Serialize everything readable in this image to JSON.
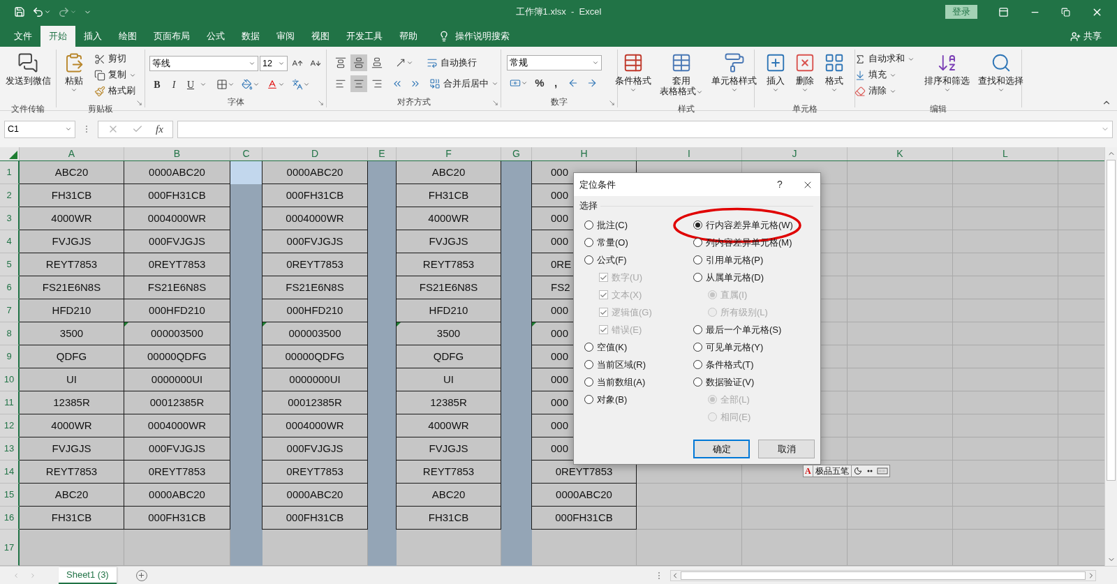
{
  "window": {
    "title": "工作簿1.xlsx  -  Excel",
    "login": "登录"
  },
  "menu_tabs": [
    {
      "label": "文件",
      "selected": false
    },
    {
      "label": "开始",
      "selected": true
    },
    {
      "label": "插入",
      "selected": false
    },
    {
      "label": "绘图",
      "selected": false
    },
    {
      "label": "页面布局",
      "selected": false
    },
    {
      "label": "公式",
      "selected": false
    },
    {
      "label": "数据",
      "selected": false
    },
    {
      "label": "审阅",
      "selected": false
    },
    {
      "label": "视图",
      "selected": false
    },
    {
      "label": "开发工具",
      "selected": false
    },
    {
      "label": "帮助",
      "selected": false
    }
  ],
  "tell_me": "操作说明搜索",
  "share": "共享",
  "ribbon": {
    "groups": [
      {
        "kind": "buttons",
        "label": "文件传输",
        "launcher": false,
        "items": [
          {
            "kind": "large",
            "lines": [
              "发送到微信"
            ],
            "menu": false
          }
        ]
      },
      {
        "kind": "buttons",
        "label": "剪贴板",
        "launcher": true,
        "items": [
          {
            "kind": "large",
            "lines": [
              "粘贴"
            ],
            "menu": true
          },
          {
            "kind": "small",
            "label": "剪切",
            "menu": false
          },
          {
            "kind": "small",
            "label": "复制",
            "menu": true
          },
          {
            "kind": "small",
            "label": "格式刷",
            "menu": false
          }
        ]
      },
      {
        "kind": "font",
        "label": "字体",
        "launcher": true,
        "font": "等线",
        "size": "12",
        "format_buttons": [
          "B",
          "I",
          "U"
        ]
      },
      {
        "kind": "alignment",
        "label": "对齐方式",
        "launcher": true,
        "vertical_align": [
          {
            "selected": false
          },
          {
            "selected": true
          },
          {
            "selected": false
          }
        ],
        "horizontal_align": [
          {
            "selected": false
          },
          {
            "selected": true
          },
          {
            "selected": false
          }
        ],
        "items": [
          {
            "kind": "small",
            "label": "自动换行",
            "menu": false
          },
          {
            "kind": "small",
            "label": "合并后居中",
            "menu": true
          }
        ]
      },
      {
        "kind": "number",
        "label": "数字",
        "launcher": true,
        "format": "常规",
        "symbols": [
          "%",
          ","
        ]
      },
      {
        "kind": "buttons",
        "label": "样式",
        "launcher": false,
        "items": [
          {
            "kind": "large",
            "lines": [
              "条件格式"
            ],
            "menu": true
          },
          {
            "kind": "large",
            "lines": [
              "套用",
              "表格格式"
            ],
            "menu": true
          },
          {
            "kind": "large",
            "lines": [
              "单元格样式"
            ],
            "menu": true
          }
        ]
      },
      {
        "kind": "buttons",
        "label": "单元格",
        "launcher": false,
        "items": [
          {
            "kind": "large",
            "lines": [
              "插入"
            ],
            "menu": true
          },
          {
            "kind": "large",
            "lines": [
              "删除"
            ],
            "menu": true
          },
          {
            "kind": "large",
            "lines": [
              "格式"
            ],
            "menu": true
          }
        ]
      },
      {
        "kind": "buttons",
        "label": "编辑",
        "launcher": false,
        "items": [
          {
            "kind": "small",
            "label": "自动求和",
            "menu": true
          },
          {
            "kind": "small",
            "label": "填充",
            "menu": true
          },
          {
            "kind": "small",
            "label": "清除",
            "menu": true
          },
          {
            "kind": "large",
            "lines": [
              "排序和筛选"
            ],
            "menu": true
          },
          {
            "kind": "large",
            "lines": [
              "查找和选择"
            ],
            "menu": true
          }
        ]
      }
    ]
  },
  "formula_bar": {
    "name_box": "C1",
    "fx": "fx"
  },
  "columns": [
    {
      "label": "A",
      "selected": false,
      "active": false
    },
    {
      "label": "B",
      "selected": false,
      "active": false
    },
    {
      "label": "C",
      "selected": true,
      "active": true
    },
    {
      "label": "D",
      "selected": false,
      "active": false
    },
    {
      "label": "E",
      "selected": true,
      "active": false
    },
    {
      "label": "F",
      "selected": false,
      "active": false
    },
    {
      "label": "G",
      "selected": true,
      "active": false
    },
    {
      "label": "H",
      "selected": false,
      "active": false
    },
    {
      "label": "I",
      "selected": false,
      "active": false
    },
    {
      "label": "J",
      "selected": false,
      "active": false
    },
    {
      "label": "K",
      "selected": false,
      "active": false
    },
    {
      "label": "L",
      "selected": false,
      "active": false
    }
  ],
  "rows": [
    {
      "header": "1",
      "a": "ABC20",
      "b": "0000ABC20",
      "d": "0000ABC20",
      "f": "ABC20",
      "h_partial": "000"
    },
    {
      "header": "2",
      "a": "FH31CB",
      "b": "000FH31CB",
      "d": "000FH31CB",
      "f": "FH31CB",
      "h_partial": "000"
    },
    {
      "header": "3",
      "a": "4000WR",
      "b": "0004000WR",
      "d": "0004000WR",
      "f": "4000WR",
      "h_partial": "000"
    },
    {
      "header": "4",
      "a": "FVJGJS",
      "b": "000FVJGJS",
      "d": "000FVJGJS",
      "f": "FVJGJS",
      "h_partial": "000"
    },
    {
      "header": "5",
      "a": "REYT7853",
      "b": "0REYT7853",
      "d": "0REYT7853",
      "f": "REYT7853",
      "h_partial": "0RE"
    },
    {
      "header": "6",
      "a": "FS21E6N8S",
      "b": "FS21E6N8S",
      "d": "FS21E6N8S",
      "f": "FS21E6N8S",
      "h_partial": "FS2"
    },
    {
      "header": "7",
      "a": "HFD210",
      "b": "000HFD210",
      "d": "000HFD210",
      "f": "HFD210",
      "h_partial": "000"
    },
    {
      "header": "8",
      "a": "3500",
      "b": "000003500",
      "d": "000003500",
      "f": "3500",
      "h_partial": "000",
      "flags": {
        "b": true,
        "d": true,
        "f": true,
        "h": true
      }
    },
    {
      "header": "9",
      "a": "QDFG",
      "b": "00000QDFG",
      "d": "00000QDFG",
      "f": "QDFG",
      "h_partial": "000"
    },
    {
      "header": "10",
      "a": "UI",
      "b": "0000000UI",
      "d": "0000000UI",
      "f": "UI",
      "h_partial": "000"
    },
    {
      "header": "11",
      "a": "12385R",
      "b": "00012385R",
      "d": "00012385R",
      "f": "12385R",
      "h_partial": "000"
    },
    {
      "header": "12",
      "a": "4000WR",
      "b": "0004000WR",
      "d": "0004000WR",
      "f": "4000WR",
      "h_partial": "000"
    },
    {
      "header": "13",
      "a": "FVJGJS",
      "b": "000FVJGJS",
      "d": "000FVJGJS",
      "f": "FVJGJS",
      "h_partial": "000"
    },
    {
      "header": "14",
      "a": "REYT7853",
      "b": "0REYT7853",
      "d": "0REYT7853",
      "f": "REYT7853",
      "h": "0REYT7853"
    },
    {
      "header": "15",
      "a": "ABC20",
      "b": "0000ABC20",
      "d": "0000ABC20",
      "f": "ABC20",
      "h": "0000ABC20"
    },
    {
      "header": "16",
      "a": "FH31CB",
      "b": "000FH31CB",
      "d": "000FH31CB",
      "f": "FH31CB",
      "h": "000FH31CB"
    },
    {
      "header": "17"
    }
  ],
  "sheet_tabs": [
    {
      "label": "Sheet1 (3)",
      "selected": true
    }
  ],
  "dialog": {
    "title": "定位条件",
    "help": "?",
    "section": "选择",
    "left_options": [
      {
        "label": "批注(C)",
        "kind": "radio",
        "selected": false,
        "disabled": false,
        "highlighted": false
      },
      {
        "label": "常量(O)",
        "kind": "radio",
        "selected": false,
        "disabled": false,
        "highlighted": false
      },
      {
        "label": "公式(F)",
        "kind": "radio",
        "selected": false,
        "disabled": false,
        "highlighted": false,
        "children": [
          {
            "label": "数字(U)",
            "kind": "check",
            "checked": true,
            "disabled": true
          },
          {
            "label": "文本(X)",
            "kind": "check",
            "checked": true,
            "disabled": true
          },
          {
            "label": "逻辑值(G)",
            "kind": "check",
            "checked": true,
            "disabled": true
          },
          {
            "label": "错误(E)",
            "kind": "check",
            "checked": true,
            "disabled": true
          }
        ]
      },
      {
        "label": "空值(K)",
        "kind": "radio",
        "selected": false,
        "disabled": false,
        "highlighted": false
      },
      {
        "label": "当前区域(R)",
        "kind": "radio",
        "selected": false,
        "disabled": false,
        "highlighted": false
      },
      {
        "label": "当前数组(A)",
        "kind": "radio",
        "selected": false,
        "disabled": false,
        "highlighted": false
      },
      {
        "label": "对象(B)",
        "kind": "radio",
        "selected": false,
        "disabled": false,
        "highlighted": false
      }
    ],
    "right_options": [
      {
        "label": "行内容差异单元格(W)",
        "kind": "radio",
        "selected": true,
        "disabled": false,
        "highlighted": true
      },
      {
        "label": "列内容差异单元格(M)",
        "kind": "radio",
        "selected": false,
        "disabled": false,
        "highlighted": false
      },
      {
        "label": "引用单元格(P)",
        "kind": "radio",
        "selected": false,
        "disabled": false,
        "highlighted": false
      },
      {
        "label": "从属单元格(D)",
        "kind": "radio",
        "selected": false,
        "disabled": false,
        "highlighted": false,
        "children": [
          {
            "label": "直属(I)",
            "kind": "radio",
            "selected": true,
            "disabled": true
          },
          {
            "label": "所有级别(L)",
            "kind": "radio",
            "selected": false,
            "disabled": true
          }
        ]
      },
      {
        "label": "最后一个单元格(S)",
        "kind": "radio",
        "selected": false,
        "disabled": false,
        "highlighted": false
      },
      {
        "label": "可见单元格(Y)",
        "kind": "radio",
        "selected": false,
        "disabled": false,
        "highlighted": false
      },
      {
        "label": "条件格式(T)",
        "kind": "radio",
        "selected": false,
        "disabled": false,
        "highlighted": false
      },
      {
        "label": "数据验证(V)",
        "kind": "radio",
        "selected": false,
        "disabled": false,
        "highlighted": false,
        "children": [
          {
            "label": "全部(L)",
            "kind": "radio",
            "selected": true,
            "disabled": true
          },
          {
            "label": "相同(E)",
            "kind": "radio",
            "selected": false,
            "disabled": true
          }
        ]
      }
    ],
    "buttons": [
      {
        "label": "确定",
        "default": true
      },
      {
        "label": "取消",
        "default": false
      }
    ]
  },
  "ime_bar": {
    "logo": "A",
    "label": "极品五笔"
  }
}
